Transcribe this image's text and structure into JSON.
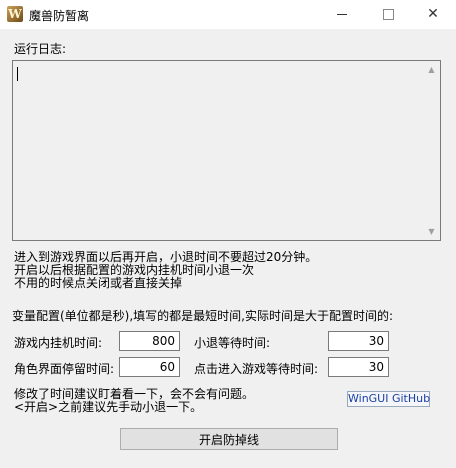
{
  "window": {
    "icon_letter": "W",
    "title": "魔兽防暂离",
    "controls": {
      "minimize": "—",
      "maximize": "☐",
      "close": "✕"
    }
  },
  "log": {
    "label": "运行日志:",
    "content": ""
  },
  "info": {
    "line1": "进入到游戏界面以后再开启，小退时间不要超过20分钟。",
    "line2": "开启以后根据配置的游戏内挂机时间小退一次",
    "line3": "不用的时候点关闭或者直接关掉"
  },
  "config": {
    "note": "变量配置(单位都是秒),填写的都是最短时间,实际时间是大于配置时间的:",
    "fields": {
      "idle_label": "游戏内挂机时间:",
      "idle_value": "800",
      "logout_wait_label": "小退等待时间:",
      "logout_wait_value": "30",
      "char_screen_label": "角色界面停留时间:",
      "char_screen_value": "60",
      "enter_game_label": "点击进入游戏等待时间:",
      "enter_game_value": "30"
    }
  },
  "hints": {
    "line1": "修改了时间建议盯着看一下，会不会有问题。",
    "line2": "<开启>之前建议先手动小退一下。"
  },
  "link": {
    "label": "WinGUI GitHub"
  },
  "actions": {
    "start_label": "开启防掉线"
  }
}
